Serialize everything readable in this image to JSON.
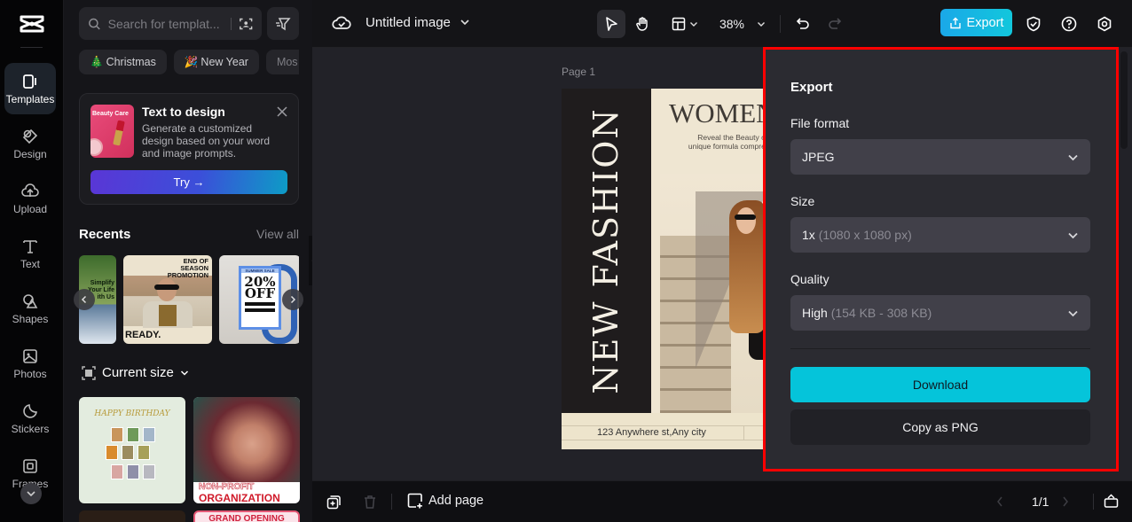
{
  "app": {
    "logo": "capcut-logo"
  },
  "rail": {
    "items": [
      {
        "label": "Templates",
        "icon": "templates-icon",
        "active": true
      },
      {
        "label": "Design",
        "icon": "design-icon"
      },
      {
        "label": "Upload",
        "icon": "upload-icon"
      },
      {
        "label": "Text",
        "icon": "text-icon"
      },
      {
        "label": "Shapes",
        "icon": "shapes-icon"
      },
      {
        "label": "Photos",
        "icon": "photos-icon"
      },
      {
        "label": "Stickers",
        "icon": "stickers-icon"
      },
      {
        "label": "Frames",
        "icon": "frames-icon"
      }
    ]
  },
  "panel": {
    "search": {
      "placeholder": "Search for templat..."
    },
    "chips": [
      {
        "emoji": "🎄",
        "label": "Christmas"
      },
      {
        "emoji": "🎉",
        "label": "New Year"
      },
      {
        "emoji": "",
        "label": "Mos"
      }
    ],
    "text_to_design": {
      "thumb_caption": "Beauty Care",
      "title": "Text to design",
      "description": "Generate a customized design based on your word and image prompts.",
      "try_label": "Try →"
    },
    "recents": {
      "title": "Recents",
      "view_all": "View all",
      "items": [
        {
          "text": "Simplify Your Life ith Us"
        },
        {
          "heading": "END OF SEASON PROMOTION",
          "footer": "READY."
        },
        {
          "heading": "SUMMER SALE",
          "big": "20% OFF"
        }
      ]
    },
    "current_size": {
      "label": "Current size"
    },
    "templates": [
      {
        "title": "HAPPY BIRTHDAY"
      },
      {
        "line1": "NON-PROFIT",
        "line2": "ORGANIZATION"
      },
      {
        "title": ""
      },
      {
        "title": "GRAND OPENING"
      }
    ]
  },
  "topbar": {
    "doc_title": "Untitled image",
    "zoom": "38%",
    "export_label": "Export"
  },
  "canvas": {
    "page_label": "Page 1",
    "design": {
      "vertical_text": "NEW FASHION",
      "heading": "WOMEN",
      "subtext": "Reveal the Beauty of Our unique formula comprehensive",
      "address": "123 Anywhere st,Any city"
    }
  },
  "bottombar": {
    "add_page": "Add page",
    "pager": "1/1"
  },
  "export_panel": {
    "title": "Export",
    "file_format": {
      "label": "File format",
      "value": "JPEG"
    },
    "size": {
      "label": "Size",
      "value": "1x",
      "detail": "(1080 x 1080 px)"
    },
    "quality": {
      "label": "Quality",
      "value": "High",
      "detail": "(154 KB - 308 KB)"
    },
    "download_label": "Download",
    "copy_label": "Copy as PNG"
  },
  "colors": {
    "accent": "#05c4da",
    "highlight_box": "#ff0000",
    "export_btn": "#12c7dc"
  }
}
